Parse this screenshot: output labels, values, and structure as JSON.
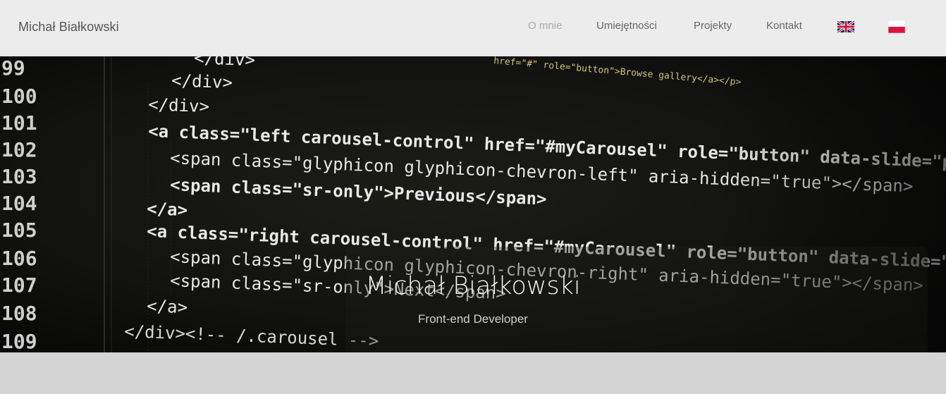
{
  "navbar": {
    "brand": "Michał Białkowski",
    "items": [
      {
        "label": "O mnie",
        "active": true
      },
      {
        "label": "Umiejętności",
        "active": false
      },
      {
        "label": "Projekty",
        "active": false
      },
      {
        "label": "Kontakt",
        "active": false
      }
    ],
    "languages": [
      {
        "name": "uk-flag-icon",
        "lang": "en"
      },
      {
        "name": "pl-flag-icon",
        "lang": "pl"
      }
    ]
  },
  "hero": {
    "title": "Michał Białkowski",
    "subtitle": "Front-end Developer",
    "code": {
      "line_numbers": [
        "99",
        "100",
        "101",
        "102",
        "103",
        "104",
        "105",
        "106",
        "107",
        "108",
        "109"
      ],
      "lines": [
        "</div>",
        "</div>",
        "</div>",
        "<a class=\"left carousel-control\" href=\"#myCarousel\" role=\"button\" data-slide=\"prev\">",
        "<span class=\"glyphicon glyphicon-chevron-left\" aria-hidden=\"true\"></span>",
        "<span class=\"sr-only\">Previous</span>",
        "</a>",
        "<a class=\"right carousel-control\" href=\"#myCarousel\" role=\"button\" data-slide=\"next\">",
        "<span class=\"glyphicon glyphicon-chevron-right\" aria-hidden=\"true\"></span>",
        "<span class=\"sr-only\">Next</span>",
        "</a>",
        "</div><!-- /.carousel -->"
      ],
      "top_fragment": "href=\"#\" role=\"button\">Browse gallery</a></p>"
    }
  },
  "colors": {
    "header_bg": "#ececec",
    "page_bg": "#d4d4d4",
    "code_text": "#e6e6e6",
    "code_attr": "#f5e08a",
    "line_number": "#cfcfcf",
    "comment": "#9a9a9a"
  }
}
